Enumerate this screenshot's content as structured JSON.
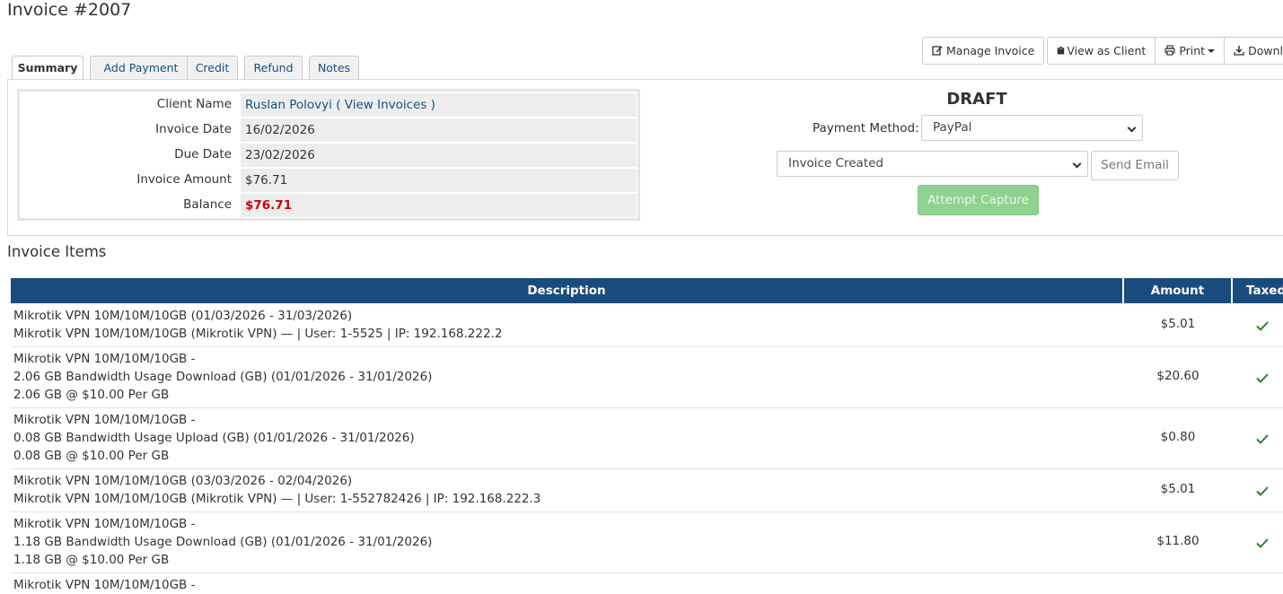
{
  "page": {
    "title": "Invoice #2007"
  },
  "actions": {
    "manage_invoice": "Manage Invoice",
    "view_as_client": "View as Client",
    "print": "Print",
    "download": "Download"
  },
  "tabs": [
    {
      "label": "Summary",
      "active": true
    },
    {
      "label": "Add Payment",
      "active": false
    },
    {
      "label": "Credit",
      "active": false
    },
    {
      "label": "Refund",
      "active": false
    },
    {
      "label": "Notes",
      "active": false
    }
  ],
  "summary": {
    "client_name_label": "Client Name",
    "client_name": "Ruslan Polovyi",
    "view_invoices_link": "( View Invoices )",
    "invoice_date_label": "Invoice Date",
    "invoice_date": "16/02/2026",
    "due_date_label": "Due Date",
    "due_date": "23/02/2026",
    "invoice_amount_label": "Invoice Amount",
    "invoice_amount": "$76.71",
    "balance_label": "Balance",
    "balance": "$76.71"
  },
  "status": {
    "draft": "DRAFT",
    "payment_method_label": "Payment Method:",
    "payment_method": "PayPal",
    "email_template": "Invoice Created",
    "send_email": "Send Email",
    "attempt_capture": "Attempt Capture"
  },
  "items_section": {
    "title": "Invoice Items",
    "columns": {
      "description": "Description",
      "amount": "Amount",
      "taxed": "Taxed"
    },
    "rows": [
      {
        "lines": [
          "Mikrotik VPN 10M/10M/10GB (01/03/2026 - 31/03/2026)",
          "Mikrotik VPN 10M/10M/10GB (Mikrotik VPN) — | User: 1-5525 | IP: 192.168.222.2"
        ],
        "amount": "$5.01",
        "taxed": true
      },
      {
        "lines": [
          "Mikrotik VPN 10M/10M/10GB -",
          "2.06 GB Bandwidth Usage Download (GB) (01/01/2026 - 31/01/2026)",
          "2.06 GB @ $10.00 Per GB"
        ],
        "amount": "$20.60",
        "taxed": true
      },
      {
        "lines": [
          "Mikrotik VPN 10M/10M/10GB -",
          "0.08 GB Bandwidth Usage Upload (GB) (01/01/2026 - 31/01/2026)",
          "0.08 GB @ $10.00 Per GB"
        ],
        "amount": "$0.80",
        "taxed": true
      },
      {
        "lines": [
          "Mikrotik VPN 10M/10M/10GB (03/03/2026 - 02/04/2026)",
          "Mikrotik VPN 10M/10M/10GB (Mikrotik VPN) — | User: 1-552782426 | IP: 192.168.222.3"
        ],
        "amount": "$5.01",
        "taxed": true
      },
      {
        "lines": [
          "Mikrotik VPN 10M/10M/10GB -",
          "1.18 GB Bandwidth Usage Download (GB) (01/01/2026 - 31/01/2026)",
          "1.18 GB @ $10.00 Per GB"
        ],
        "amount": "$11.80",
        "taxed": true
      },
      {
        "lines": [
          "Mikrotik VPN 10M/10M/10GB -"
        ],
        "amount": "",
        "taxed": false
      }
    ]
  },
  "colors": {
    "header_bg": "#1a4b7d",
    "link": "#1a4f7f",
    "balance": "#cc0000",
    "check": "#2e7d32",
    "capture_btn": "#8fd18f"
  }
}
